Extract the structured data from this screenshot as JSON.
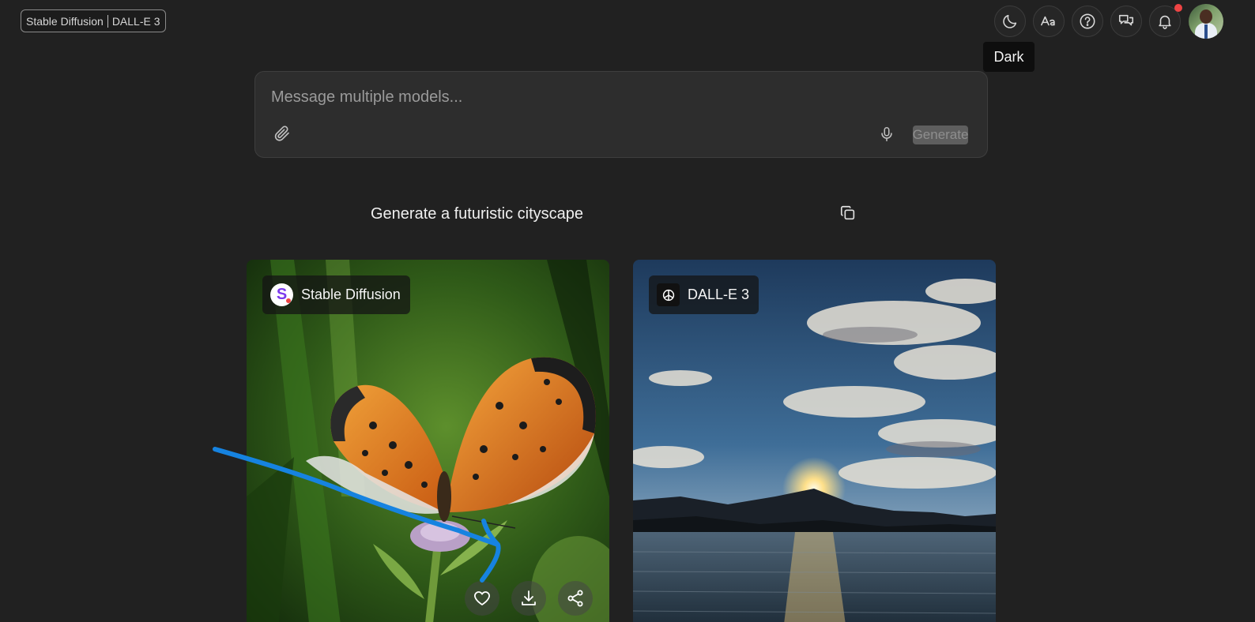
{
  "header": {
    "selected_models": [
      "Stable Diffusion",
      "DALL-E 3"
    ],
    "icons": [
      "moon-icon",
      "font-size-icon",
      "help-icon",
      "chat-icon",
      "bell-icon"
    ],
    "tooltip": "Dark",
    "notification_dot_color": "#ef4444"
  },
  "composer": {
    "placeholder": "Message multiple models...",
    "generate_label": "Generate"
  },
  "prompt": {
    "text": "Generate a futuristic cityscape"
  },
  "results": [
    {
      "model": "Stable Diffusion",
      "image": "butterfly on a thistle flower"
    },
    {
      "model": "DALL-E 3",
      "image": "sunset over a lake and mountain"
    }
  ],
  "card_actions": [
    "heart-icon",
    "download-icon",
    "share-icon"
  ],
  "colors": {
    "background": "#212121",
    "annotation_stroke": "#1683e0"
  }
}
